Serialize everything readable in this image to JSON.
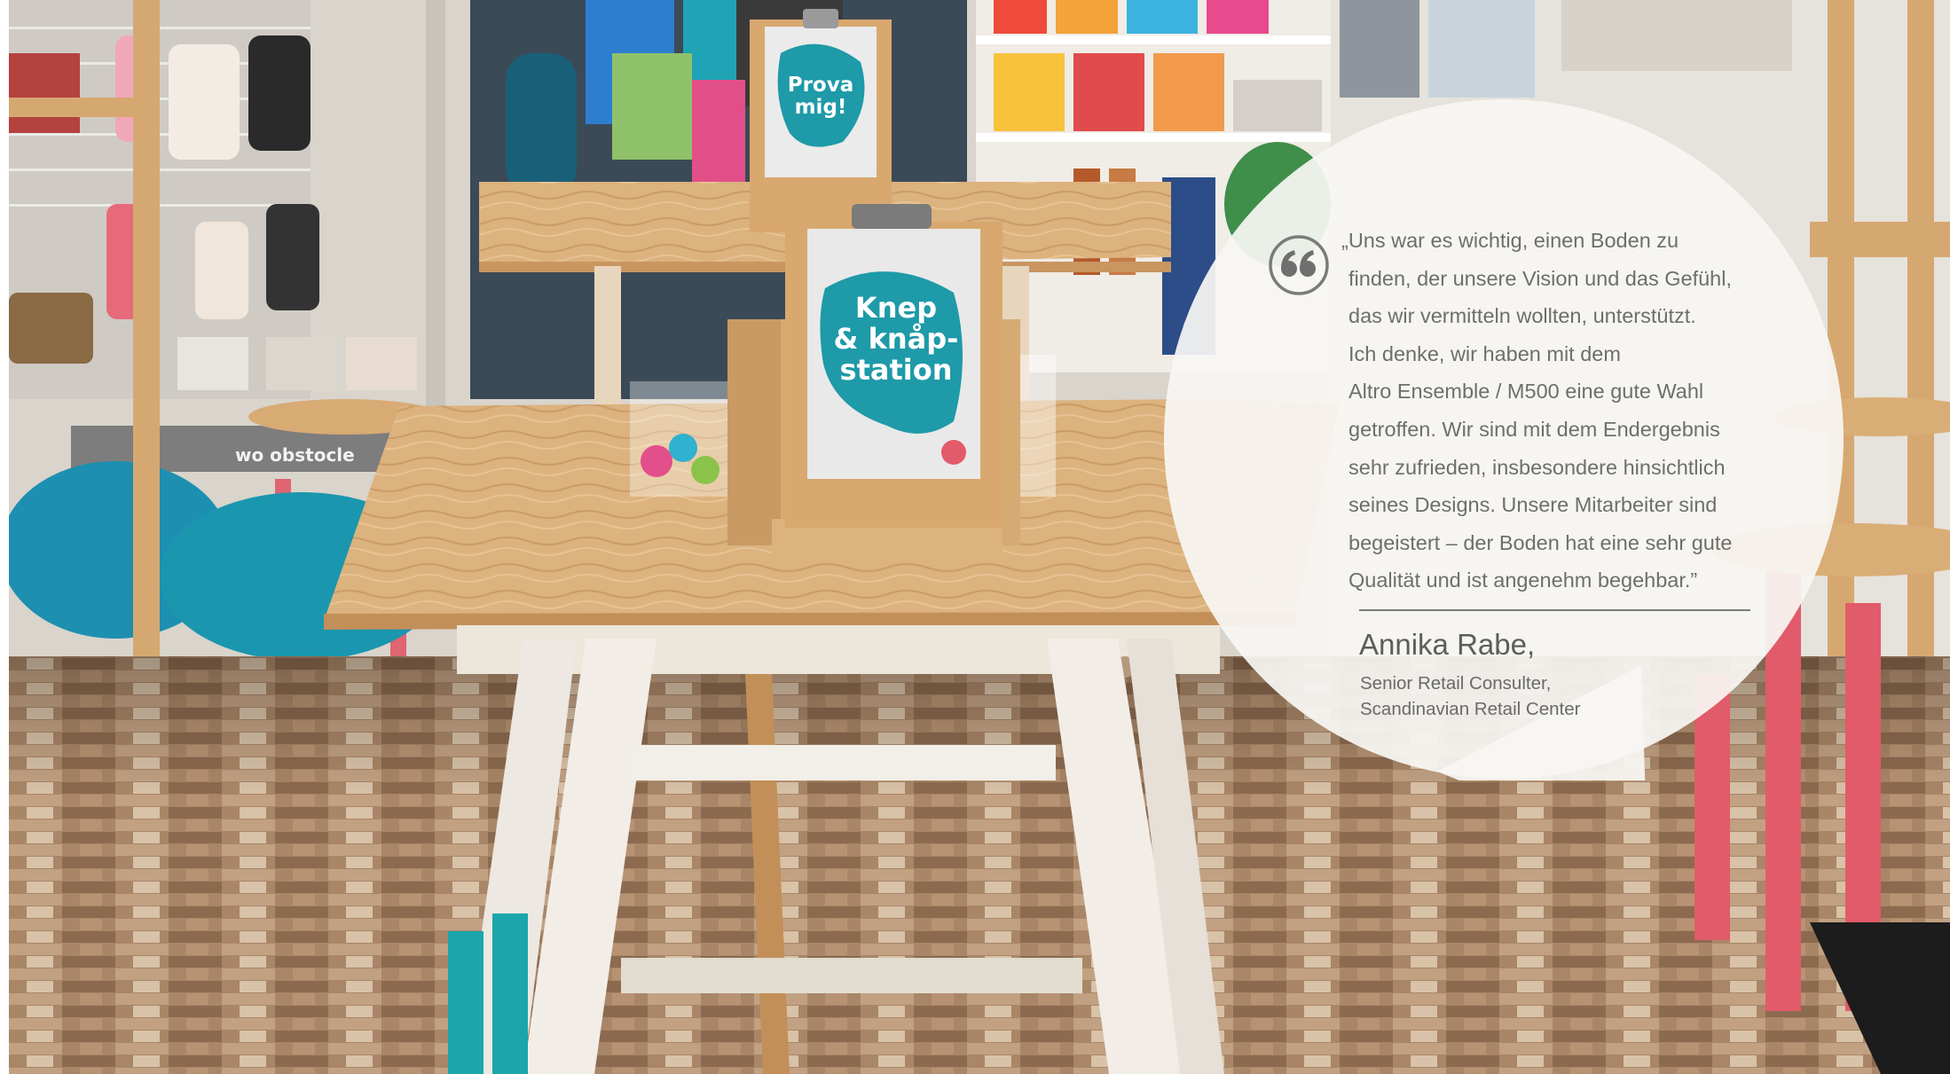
{
  "store_signs": {
    "prova": [
      "Prova",
      "mig!"
    ],
    "knep": [
      "Knep",
      "& knåp-",
      "station"
    ],
    "shelf": "wo obstocle"
  },
  "colors": {
    "teal": "#1e9aa8",
    "wood": "#d8ae78",
    "bubble": "#f6f5f2",
    "floor": "#a88466",
    "text": "#6e6e6e"
  },
  "quote": {
    "icon": "quote-icon",
    "lines": [
      "„Uns war es wichtig, einen Boden zu",
      "finden, der unsere Vision und das Gefühl,",
      "das wir vermitteln wollten, unterstützt.",
      "Ich denke, wir haben mit dem",
      "Altro Ensemble / M500 eine gute Wahl",
      "getroffen. Wir sind mit dem Endergebnis",
      "sehr zufrieden, insbesondere hinsichtlich",
      "seines Designs. Unsere Mitarbeiter sind",
      "begeistert – der Boden hat eine sehr gute",
      "Qualität und ist angenehm begehbar.”"
    ]
  },
  "author": {
    "name": "Annika Rabe,",
    "role_line1": "Senior Retail Consulter,",
    "role_line2": "Scandinavian Retail Center"
  }
}
